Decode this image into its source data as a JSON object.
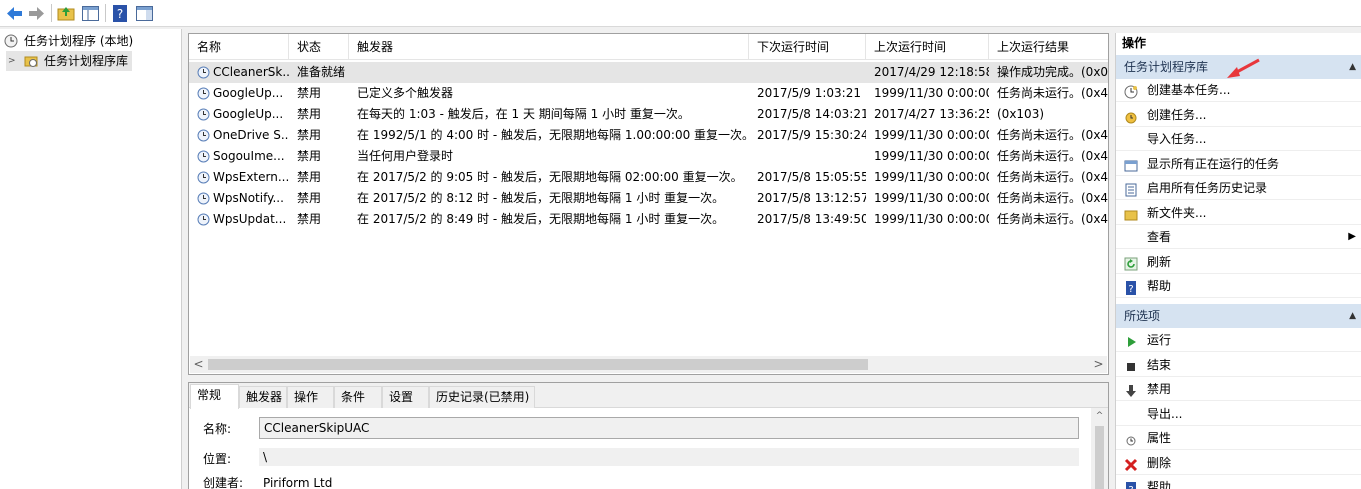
{
  "toolbar": {
    "icons": [
      "back-icon",
      "forward-icon",
      "folder-up-icon",
      "console-tree-icon",
      "help-icon",
      "action-pane-icon"
    ]
  },
  "tree": {
    "root_label": "任务计划程序 (本地)",
    "child_label": "任务计划程序库"
  },
  "grid": {
    "columns": [
      "名称",
      "状态",
      "触发器",
      "下次运行时间",
      "上次运行时间",
      "上次运行结果"
    ],
    "rows": [
      {
        "name": "CCleanerSk...",
        "status": "准备就绪",
        "trigger": "",
        "next": "",
        "last": "2017/4/29 12:18:58",
        "result": "操作成功完成。(0x0"
      },
      {
        "name": "GoogleUp...",
        "status": "禁用",
        "trigger": "已定义多个触发器",
        "next": "2017/5/9 1:03:21",
        "last": "1999/11/30 0:00:00",
        "result": "任务尚未运行。(0x4"
      },
      {
        "name": "GoogleUp...",
        "status": "禁用",
        "trigger": "在每天的 1:03 - 触发后，在 1 天 期间每隔 1 小时 重复一次。",
        "next": "2017/5/8 14:03:21",
        "last": "2017/4/27 13:36:25",
        "result": "(0x103)"
      },
      {
        "name": "OneDrive S...",
        "status": "禁用",
        "trigger": "在 1992/5/1 的 4:00 时 - 触发后，无限期地每隔 1.00:00:00 重复一次。",
        "next": "2017/5/9 15:30:24",
        "last": "1999/11/30 0:00:00",
        "result": "任务尚未运行。(0x4"
      },
      {
        "name": "SogouIme...",
        "status": "禁用",
        "trigger": "当任何用户登录时",
        "next": "",
        "last": "1999/11/30 0:00:00",
        "result": "任务尚未运行。(0x4"
      },
      {
        "name": "WpsExtern...",
        "status": "禁用",
        "trigger": "在 2017/5/2 的 9:05 时 - 触发后，无限期地每隔 02:00:00 重复一次。",
        "next": "2017/5/8 15:05:55",
        "last": "1999/11/30 0:00:00",
        "result": "任务尚未运行。(0x4"
      },
      {
        "name": "WpsNotify...",
        "status": "禁用",
        "trigger": "在 2017/5/2 的 8:12 时 - 触发后，无限期地每隔 1 小时 重复一次。",
        "next": "2017/5/8 13:12:57",
        "last": "1999/11/30 0:00:00",
        "result": "任务尚未运行。(0x4"
      },
      {
        "name": "WpsUpdat...",
        "status": "禁用",
        "trigger": "在 2017/5/2 的 8:49 时 - 触发后，无限期地每隔 1 小时 重复一次。",
        "next": "2017/5/8 13:49:50",
        "last": "1999/11/30 0:00:00",
        "result": "任务尚未运行。(0x4"
      }
    ]
  },
  "detail": {
    "tabs": [
      "常规",
      "触发器",
      "操作",
      "条件",
      "设置",
      "历史记录(已禁用)"
    ],
    "name_label": "名称:",
    "name_value": "CCleanerSkipUAC",
    "location_label": "位置:",
    "location_value": "\\",
    "author_label": "创建者:",
    "author_value": "Piriform Ltd"
  },
  "actions": {
    "title": "操作",
    "section1": "任务计划程序库",
    "items1": [
      {
        "label": "创建基本任务...",
        "icon": "create-basic-task-icon"
      },
      {
        "label": "创建任务...",
        "icon": "create-task-icon"
      },
      {
        "label": "导入任务...",
        "icon": ""
      },
      {
        "label": "显示所有正在运行的任务",
        "icon": "running-tasks-icon"
      },
      {
        "label": "启用所有任务历史记录",
        "icon": "history-icon"
      },
      {
        "label": "新文件夹...",
        "icon": "folder-icon"
      },
      {
        "label": "查看",
        "icon": ""
      },
      {
        "label": "刷新",
        "icon": "refresh-icon"
      },
      {
        "label": "帮助",
        "icon": "help-icon"
      }
    ],
    "section2": "所选项",
    "items2": [
      {
        "label": "运行",
        "icon": "run-icon"
      },
      {
        "label": "结束",
        "icon": "stop-icon"
      },
      {
        "label": "禁用",
        "icon": "disable-icon"
      },
      {
        "label": "导出...",
        "icon": ""
      },
      {
        "label": "属性",
        "icon": "properties-icon"
      },
      {
        "label": "删除",
        "icon": "delete-icon"
      },
      {
        "label": "帮助",
        "icon": "help-icon"
      }
    ]
  },
  "colors": {
    "section_bg": "#d6e3f1",
    "selection": "#e5e5e5",
    "arrow_red": "#e8373c"
  }
}
